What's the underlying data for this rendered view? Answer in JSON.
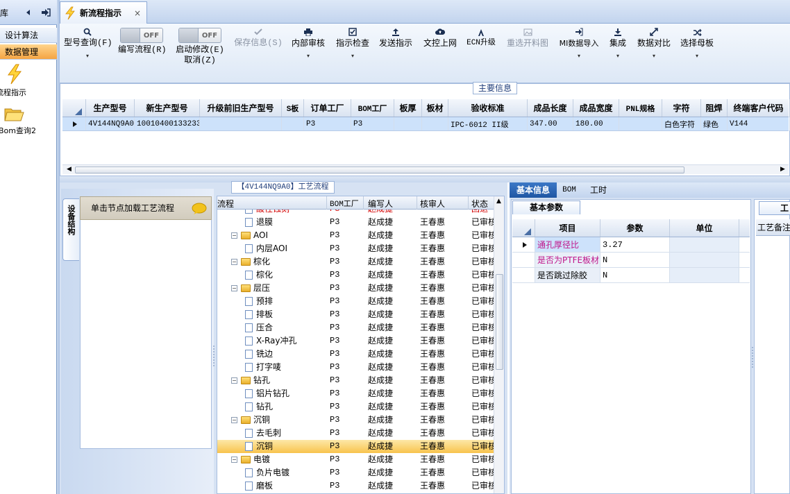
{
  "left_nav": {
    "title_fragment": "库",
    "sections": [
      "设计算法",
      "数据管理"
    ],
    "items": [
      {
        "label": "流程指示",
        "icon": "lightning-icon"
      },
      {
        "label": "Bom查询2",
        "icon": "folder-open-icon"
      }
    ]
  },
  "tab": {
    "label": "新流程指示",
    "close": "×"
  },
  "toolbar": {
    "buttons": [
      {
        "label": "型号查询(F)",
        "icon": "search-icon",
        "arrow": "▾"
      },
      {
        "label": "编写流程(R)",
        "toggle": "OFF"
      },
      {
        "label": "启动修改(E)",
        "label2": "取消(Z)",
        "toggle": "OFF"
      },
      {
        "label": "保存信息(S)",
        "icon": "check-icon",
        "disabled": true
      },
      {
        "label": "内部审核",
        "icon": "printer-icon",
        "arrow": "▾"
      },
      {
        "label": "指示检查",
        "icon": "checkbox-icon",
        "arrow": "▾"
      },
      {
        "label": "发送指示",
        "icon": "upload-icon"
      },
      {
        "label": "文控上网",
        "icon": "cloud-upload-icon"
      },
      {
        "label": "ECN升级",
        "icon": "upgrade-icon"
      },
      {
        "label": "重选开料图",
        "icon": "image-icon",
        "disabled": true
      },
      {
        "label": "MI数据导入",
        "icon": "import-icon",
        "arrow": "▾"
      },
      {
        "label": "集成",
        "icon": "download-icon",
        "arrow": "▾"
      },
      {
        "label": "数据对比",
        "icon": "compare-icon",
        "arrow": "▾"
      },
      {
        "label": "选择母板",
        "icon": "shuffle-icon",
        "arrow": "▾"
      }
    ]
  },
  "main_info": {
    "title": "主要信息",
    "columns": [
      "生产型号",
      "新生产型号",
      "升级前旧生产型号",
      "S板",
      "订单工厂",
      "BOM工厂",
      "板厚",
      "板材",
      "验收标准",
      "成品长度",
      "成品宽度",
      "PNL规格",
      "字符",
      "阻焊",
      "终端客户代码"
    ],
    "row": [
      "4V144NQ9A0",
      "10010400133233",
      "",
      "",
      "P3",
      "P3",
      "",
      "",
      "IPC-6012 II级",
      "347.00",
      "180.00",
      "",
      "白色字符",
      "绿色",
      "V144"
    ]
  },
  "process": {
    "title": "【4V144NQ9A0】工艺流程",
    "side_tab": "设备结构",
    "hint": "单击节点加载工艺流程",
    "columns": [
      "流程",
      "BOM工厂",
      "编写人",
      "核审人",
      "状态"
    ],
    "rows": [
      {
        "name": "酸性蚀刻",
        "level": 2,
        "type": "doc",
        "bom": "P3",
        "writer": "赵成捷",
        "reviewer": "",
        "status": "回退",
        "red": true
      },
      {
        "name": "退膜",
        "level": 2,
        "type": "doc",
        "bom": "P3",
        "writer": "赵成捷",
        "reviewer": "王春惠",
        "status": "已审核"
      },
      {
        "name": "AOI",
        "level": 1,
        "type": "folder",
        "bom": "P3",
        "writer": "赵成捷",
        "reviewer": "王春惠",
        "status": "已审核"
      },
      {
        "name": "内层AOI",
        "level": 2,
        "type": "doc",
        "bom": "P3",
        "writer": "赵成捷",
        "reviewer": "王春惠",
        "status": "已审核"
      },
      {
        "name": "棕化",
        "level": 1,
        "type": "folder",
        "bom": "P3",
        "writer": "赵成捷",
        "reviewer": "王春惠",
        "status": "已审核"
      },
      {
        "name": "棕化",
        "level": 2,
        "type": "doc",
        "bom": "P3",
        "writer": "赵成捷",
        "reviewer": "王春惠",
        "status": "已审核"
      },
      {
        "name": "层压",
        "level": 1,
        "type": "folder",
        "bom": "P3",
        "writer": "赵成捷",
        "reviewer": "王春惠",
        "status": "已审核"
      },
      {
        "name": "预排",
        "level": 2,
        "type": "doc",
        "bom": "P3",
        "writer": "赵成捷",
        "reviewer": "王春惠",
        "status": "已审核"
      },
      {
        "name": "排板",
        "level": 2,
        "type": "doc",
        "bom": "P3",
        "writer": "赵成捷",
        "reviewer": "王春惠",
        "status": "已审核"
      },
      {
        "name": "压合",
        "level": 2,
        "type": "doc",
        "bom": "P3",
        "writer": "赵成捷",
        "reviewer": "王春惠",
        "status": "已审核"
      },
      {
        "name": "X-Ray冲孔",
        "level": 2,
        "type": "doc",
        "bom": "P3",
        "writer": "赵成捷",
        "reviewer": "王春惠",
        "status": "已审核"
      },
      {
        "name": "铣边",
        "level": 2,
        "type": "doc",
        "bom": "P3",
        "writer": "赵成捷",
        "reviewer": "王春惠",
        "status": "已审核"
      },
      {
        "name": "打字唛",
        "level": 2,
        "type": "doc",
        "bom": "P3",
        "writer": "赵成捷",
        "reviewer": "王春惠",
        "status": "已审核"
      },
      {
        "name": "钻孔",
        "level": 1,
        "type": "folder",
        "bom": "P3",
        "writer": "赵成捷",
        "reviewer": "王春惠",
        "status": "已审核"
      },
      {
        "name": "铝片钻孔",
        "level": 2,
        "type": "doc",
        "bom": "P3",
        "writer": "赵成捷",
        "reviewer": "王春惠",
        "status": "已审核"
      },
      {
        "name": "钻孔",
        "level": 2,
        "type": "doc",
        "bom": "P3",
        "writer": "赵成捷",
        "reviewer": "王春惠",
        "status": "已审核"
      },
      {
        "name": "沉铜",
        "level": 1,
        "type": "folder",
        "bom": "P3",
        "writer": "赵成捷",
        "reviewer": "王春惠",
        "status": "已审核"
      },
      {
        "name": "去毛刺",
        "level": 2,
        "type": "doc",
        "bom": "P3",
        "writer": "赵成捷",
        "reviewer": "王春惠",
        "status": "已审核"
      },
      {
        "name": "沉铜",
        "level": 2,
        "type": "doc",
        "bom": "P3",
        "writer": "赵成捷",
        "reviewer": "王春惠",
        "status": "已审核",
        "selected": true
      },
      {
        "name": "电镀",
        "level": 1,
        "type": "folder",
        "bom": "P3",
        "writer": "赵成捷",
        "reviewer": "王春惠",
        "status": "已审核"
      },
      {
        "name": "负片电镀",
        "level": 2,
        "type": "doc",
        "bom": "P3",
        "writer": "赵成捷",
        "reviewer": "王春惠",
        "status": "已审核"
      },
      {
        "name": "磨板",
        "level": 2,
        "type": "doc",
        "bom": "P3",
        "writer": "赵成捷",
        "reviewer": "王春惠",
        "status": "已审核"
      }
    ]
  },
  "right_panel": {
    "tabs": [
      "基本信息",
      "BOM",
      "工时"
    ],
    "basic_title": "基本参数",
    "columns": [
      "项目",
      "参数",
      "单位"
    ],
    "rows": [
      {
        "item": "通孔厚径比",
        "value": "3.27",
        "unit": "",
        "pink": true
      },
      {
        "item": "是否为PTFE板材",
        "value": "N",
        "unit": "",
        "pink": true
      },
      {
        "item": "是否跳过除胶",
        "value": "N",
        "unit": "",
        "pink": false
      }
    ],
    "far_tab": "工",
    "far_label": "工艺备注"
  },
  "colors": {
    "accent": "#f4a443",
    "header_blue": "#c2d4ee",
    "pink_text": "#c0158a",
    "red_text": "#d20000"
  }
}
